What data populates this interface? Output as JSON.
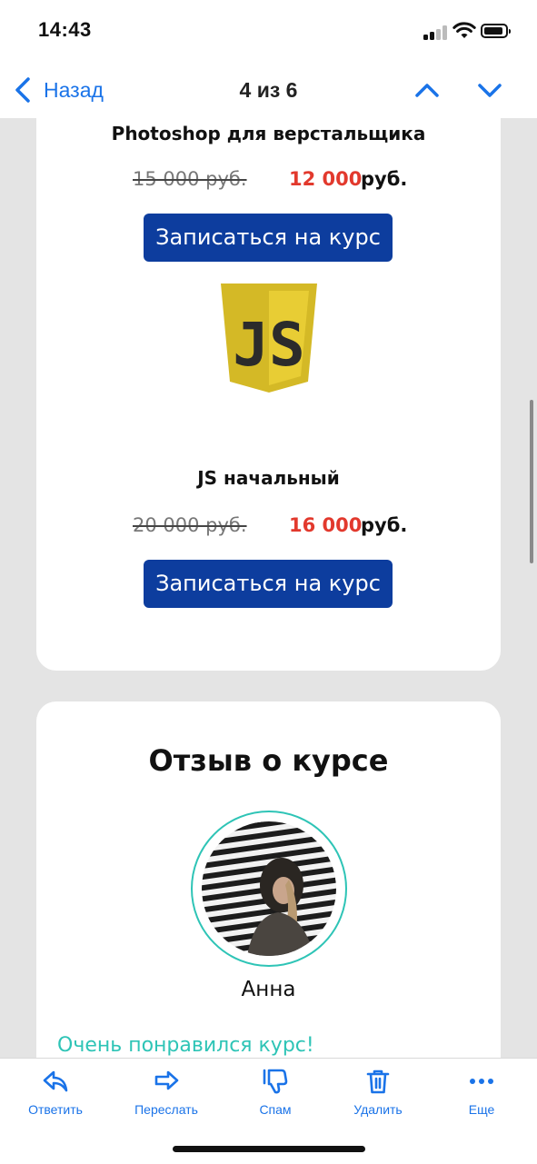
{
  "status_bar": {
    "time": "14:43"
  },
  "nav": {
    "back_label": "Назад",
    "counter": "4 из 6"
  },
  "courses": [
    {
      "title": "Photoshop для верстальщика",
      "old_price": "15 000 руб.",
      "new_price": "12 000",
      "currency": "руб.",
      "button": "Записаться на курс"
    },
    {
      "title": "JS начальный",
      "logo_text": "JS",
      "old_price": "20 000 руб.",
      "new_price": "16 000",
      "currency": "руб.",
      "button": "Записаться на курс"
    }
  ],
  "review": {
    "title": "Отзыв о курсе",
    "name": "Анна",
    "text": "Очень понравился курс!"
  },
  "toolbar": [
    {
      "label": "Ответить",
      "icon": "reply-icon"
    },
    {
      "label": "Переслать",
      "icon": "forward-icon"
    },
    {
      "label": "Спам",
      "icon": "thumbs-down-icon"
    },
    {
      "label": "Удалить",
      "icon": "trash-icon"
    },
    {
      "label": "Еще",
      "icon": "more-icon"
    }
  ],
  "colors": {
    "accent": "#1a73e8",
    "button": "#0d3d9e",
    "sale_price": "#e2392d",
    "teal": "#2ec4b6",
    "js_yellow": "#d4b926"
  }
}
